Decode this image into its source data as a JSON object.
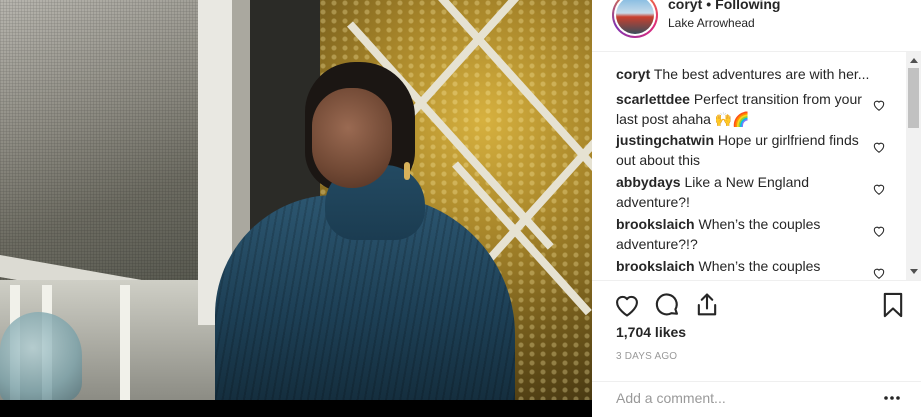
{
  "header": {
    "username": "coryt",
    "separator": "•",
    "follow_status": "Following",
    "location": "Lake Arrowhead"
  },
  "comments": [
    {
      "user": "coryt",
      "text": "The best adventures are with her...",
      "has_like": false
    },
    {
      "user": "scarlettdee",
      "text": "Perfect transition from your last post ahaha 🙌🌈",
      "has_like": true
    },
    {
      "user": "justingchatwin",
      "text": "Hope ur girlfriend finds out about this",
      "has_like": true
    },
    {
      "user": "abbydays",
      "text": "Like a New England adventure?!",
      "has_like": true
    },
    {
      "user": "brookslaich",
      "text": "When’s the couples adventure?!?",
      "has_like": true
    },
    {
      "user": "brookslaich",
      "text": "When’s the couples adventure?!?",
      "has_like": true
    }
  ],
  "actions": {
    "like_icon": "heart-outline-icon",
    "comment_icon": "comment-bubble-icon",
    "share_icon": "share-icon",
    "save_icon": "bookmark-icon"
  },
  "likes": "1,704 likes",
  "timestamp": "3 DAYS AGO",
  "add_comment": {
    "placeholder": "Add a comment...",
    "more_icon": "more-dots-icon"
  },
  "colors": {
    "text": "#262626",
    "muted": "#999999",
    "divider": "#efefef",
    "background": "#ffffff"
  }
}
